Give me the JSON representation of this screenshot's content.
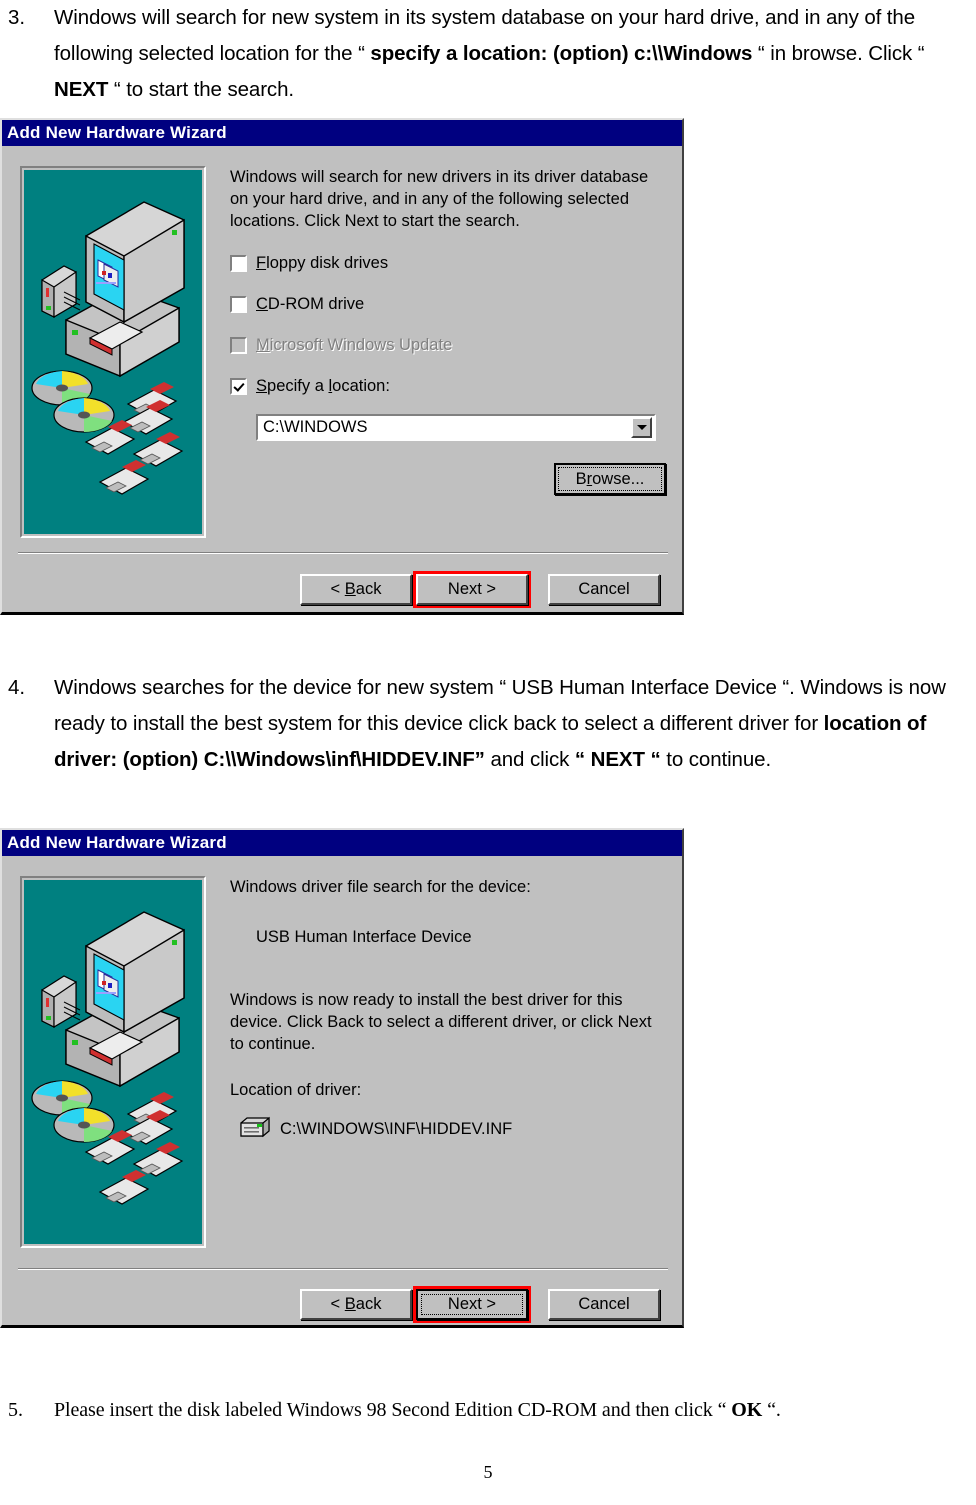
{
  "document": {
    "items": [
      {
        "number": "3.",
        "segments": [
          {
            "text": "Windows will search for new system in its system database on your hard drive, and in any of the following selected location for the “ ",
            "bold": false
          },
          {
            "text": "specify a location: (option) c:\\\\Windows",
            "bold": true
          },
          {
            "text": " “ in browse. Click “ ",
            "bold": false
          },
          {
            "text": "NEXT",
            "bold": true
          },
          {
            "text": " “ to start the search.",
            "bold": false
          }
        ]
      },
      {
        "number": "4.",
        "segments": [
          {
            "text": "Windows searches for the device for new system “ USB Human Interface Device “. Windows is now ready to install the best system for this device click back to select a different driver for ",
            "bold": false
          },
          {
            "text": "location of driver: (option) C:\\\\Windows\\inf\\HIDDEV.INF”",
            "bold": true
          },
          {
            "text": " and click ",
            "bold": false
          },
          {
            "text": "“ NEXT “",
            "bold": true
          },
          {
            "text": " to continue.",
            "bold": false
          }
        ]
      },
      {
        "number": "5.",
        "segments": [
          {
            "text": "Please insert the disk labeled Windows 98 Second Edition CD-ROM and then click “ ",
            "bold": false
          },
          {
            "text": "OK",
            "bold": true
          },
          {
            "text": " “.",
            "bold": false
          }
        ]
      }
    ],
    "page_number": "5"
  },
  "dialog1": {
    "title": "Add New Hardware Wizard",
    "body_text": "Windows will search for new drivers in its driver database\non your hard drive, and in any of the following selected\nlocations. Click Next to start the search.",
    "checkboxes": [
      {
        "label_accel": "F",
        "label_rest": "loppy disk drives",
        "checked": false,
        "disabled": false
      },
      {
        "label_accel": "C",
        "label_rest": "D-ROM drive",
        "checked": false,
        "disabled": false
      },
      {
        "label_accel": "M",
        "label_rest": "icrosoft Windows Update",
        "checked": false,
        "disabled": true
      },
      {
        "label_accel": "S",
        "label_rest": "pecify a location:",
        "checked": true,
        "disabled": false,
        "accel_position": "inline",
        "label_pre": "S",
        "label_mid": "pecify a "
      }
    ],
    "specify_label_pre": "S",
    "specify_label_mid": "pecify a ",
    "specify_label_accel": "l",
    "specify_label_post": "ocation:",
    "location_value": "C:\\WINDOWS",
    "browse_pre": "B",
    "browse_accel": "r",
    "browse_post": "owse...",
    "buttons": {
      "back_pre": "< ",
      "back_accel": "B",
      "back_post": "ack",
      "next": "Next >",
      "cancel": "Cancel"
    }
  },
  "dialog2": {
    "title": "Add New Hardware Wizard",
    "search_label": "Windows driver file search for the device:",
    "device_name": "USB Human Interface Device",
    "ready_text": "Windows is now ready to install the best driver for this\ndevice. Click Back to select a different driver, or click Next\nto continue.",
    "location_label": "Location of driver:",
    "location_path": "C:\\WINDOWS\\INF\\HIDDEV.INF",
    "buttons": {
      "back_pre": "< ",
      "back_accel": "B",
      "back_post": "ack",
      "next": "Next >",
      "cancel": "Cancel"
    }
  },
  "colors": {
    "titlebar": "#000080",
    "dialog_face": "#c0c0c0",
    "illustration_bg": "#008080",
    "highlight_annotation": "#ff0000",
    "disabled_text": "#808080"
  },
  "icons": {
    "checkbox": "checkbox-icon",
    "dropdown": "chevron-down-icon",
    "drive": "drive-icon",
    "computer": "computer-illustration-icon"
  }
}
